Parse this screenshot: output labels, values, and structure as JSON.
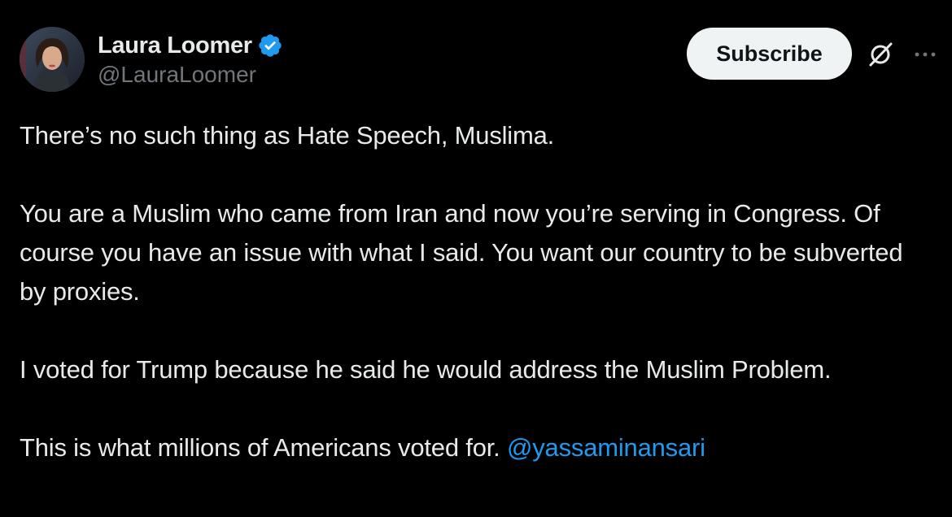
{
  "author": {
    "display_name": "Laura Loomer",
    "handle": "@LauraLoomer",
    "verified": true,
    "verified_color": "#1d9bf0"
  },
  "actions": {
    "subscribe_label": "Subscribe",
    "grok_icon": "grok-icon",
    "more_icon": "more-icon"
  },
  "tweet": {
    "paragraphs": [
      "There’s no such thing as Hate Speech, Muslima.",
      "You are a Muslim who came from Iran and now you’re serving in Congress. Of course you have an issue with what I said. You want our country to be subverted by proxies.",
      "I voted for Trump because he said he would address the Muslim Problem."
    ],
    "last_paragraph_text": "This is what millions of Americans voted for. ",
    "mention": "@yassaminansari"
  },
  "colors": {
    "background": "#000000",
    "text": "#e7e9ea",
    "secondary": "#71767b",
    "link": "#1d9bf0"
  }
}
